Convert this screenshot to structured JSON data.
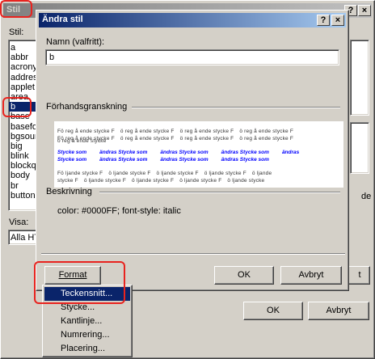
{
  "bg_window": {
    "title": "Stil",
    "help_btn": "?",
    "close_btn": "×",
    "stil_label": "Stil:",
    "styles": [
      "a",
      "abbr",
      "acrony",
      "address",
      "applet",
      "area",
      "b",
      "base",
      "basefo",
      "bgsour",
      "big",
      "blink",
      "blockq",
      "body",
      "br",
      "button"
    ],
    "selected_index": 6,
    "visa_label": "Visa:",
    "visa_value": "Alla HT",
    "ok_label": "OK",
    "cancel_label": "Avbryt",
    "partial_right_label": "de",
    "partial_t_label": "t"
  },
  "dialog": {
    "title": "Ändra stil",
    "help_btn": "?",
    "close_btn": "×",
    "name_label": "Namn (valfritt):",
    "name_value": "b",
    "preview_label": "Förhandsgranskning",
    "preview_before": [
      "Fö reg å ende stycke F",
      "ö reg å ende stycke F",
      "ö reg å ende stycke F",
      "ö reg å ende stycke F",
      "ö reg å ende stycke"
    ],
    "preview_before2": [
      "Fö reg å ende stycke F",
      "ö reg å ende stycke F",
      "ö reg å ende stycke F",
      "ö reg å ende stycke F"
    ],
    "preview_sample": [
      "Stycke som",
      "ändras Stycke som",
      "ändras Stycke som",
      "ändras Stycke som",
      "ändras"
    ],
    "preview_sample2": [
      "Stycke som",
      "ändras Stycke som",
      "ändras Stycke som",
      "ändras Stycke som"
    ],
    "preview_after": [
      "Fö ljande stycke F",
      "ö ljande stycke F",
      "ö ljande stycke F",
      "ö ljande stycke F",
      "ö ljande"
    ],
    "preview_after2": [
      "stycke F",
      "ö ljande stycke F",
      "ö ljande stycke F",
      "ö ljande stycke F",
      "ö ljande stycke"
    ],
    "description_label": "Beskrivning",
    "description_value": "color: #0000FF; font-style: italic",
    "format_label": "Format",
    "ok_label": "OK",
    "cancel_label": "Avbryt"
  },
  "menu": {
    "items": [
      "Teckensnitt...",
      "Stycke...",
      "Kantlinje...",
      "Numrering...",
      "Placering..."
    ],
    "highlight_index": 0
  },
  "colors": {
    "accent": "#0a246a",
    "annotation": "#e8231f",
    "preview_blue": "#0000ff"
  }
}
